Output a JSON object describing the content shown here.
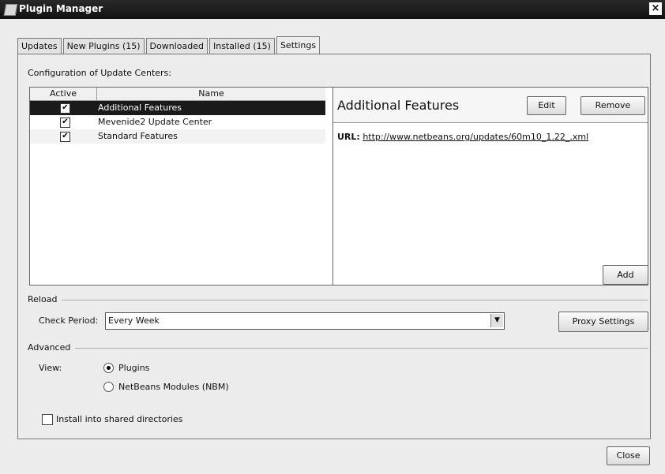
{
  "window": {
    "title": "Plugin Manager",
    "close_glyph": "×"
  },
  "tabs": [
    {
      "label": "Updates"
    },
    {
      "label": "New Plugins (15)"
    },
    {
      "label": "Downloaded"
    },
    {
      "label": "Installed (15)"
    },
    {
      "label": "Settings",
      "active": true
    }
  ],
  "settings": {
    "config_label": "Configuration of Update Centers:",
    "columns": {
      "active": "Active",
      "name": "Name"
    },
    "centers": [
      {
        "name": "Additional Features",
        "active": true,
        "selected": true
      },
      {
        "name": "Mevenide2 Update Center",
        "active": true
      },
      {
        "name": "Standard Features",
        "active": true
      }
    ],
    "detail": {
      "title": "Additional Features",
      "edit_label": "Edit",
      "remove_label": "Remove",
      "url_label": "URL:",
      "url": "http://www.netbeans.org/updates/60m10_1.22_.xml"
    },
    "add_label": "Add",
    "reload": {
      "section": "Reload",
      "check_period_label": "Check Period:",
      "check_period_value": "Every Week",
      "proxy_label": "Proxy Settings"
    },
    "advanced": {
      "section": "Advanced",
      "view_label": "View:",
      "options": [
        {
          "label": "Plugins",
          "selected": true
        },
        {
          "label": "NetBeans Modules (NBM)",
          "selected": false
        }
      ],
      "shared_label": "Install into shared directories",
      "shared_checked": false
    }
  },
  "footer": {
    "close_label": "Close"
  }
}
